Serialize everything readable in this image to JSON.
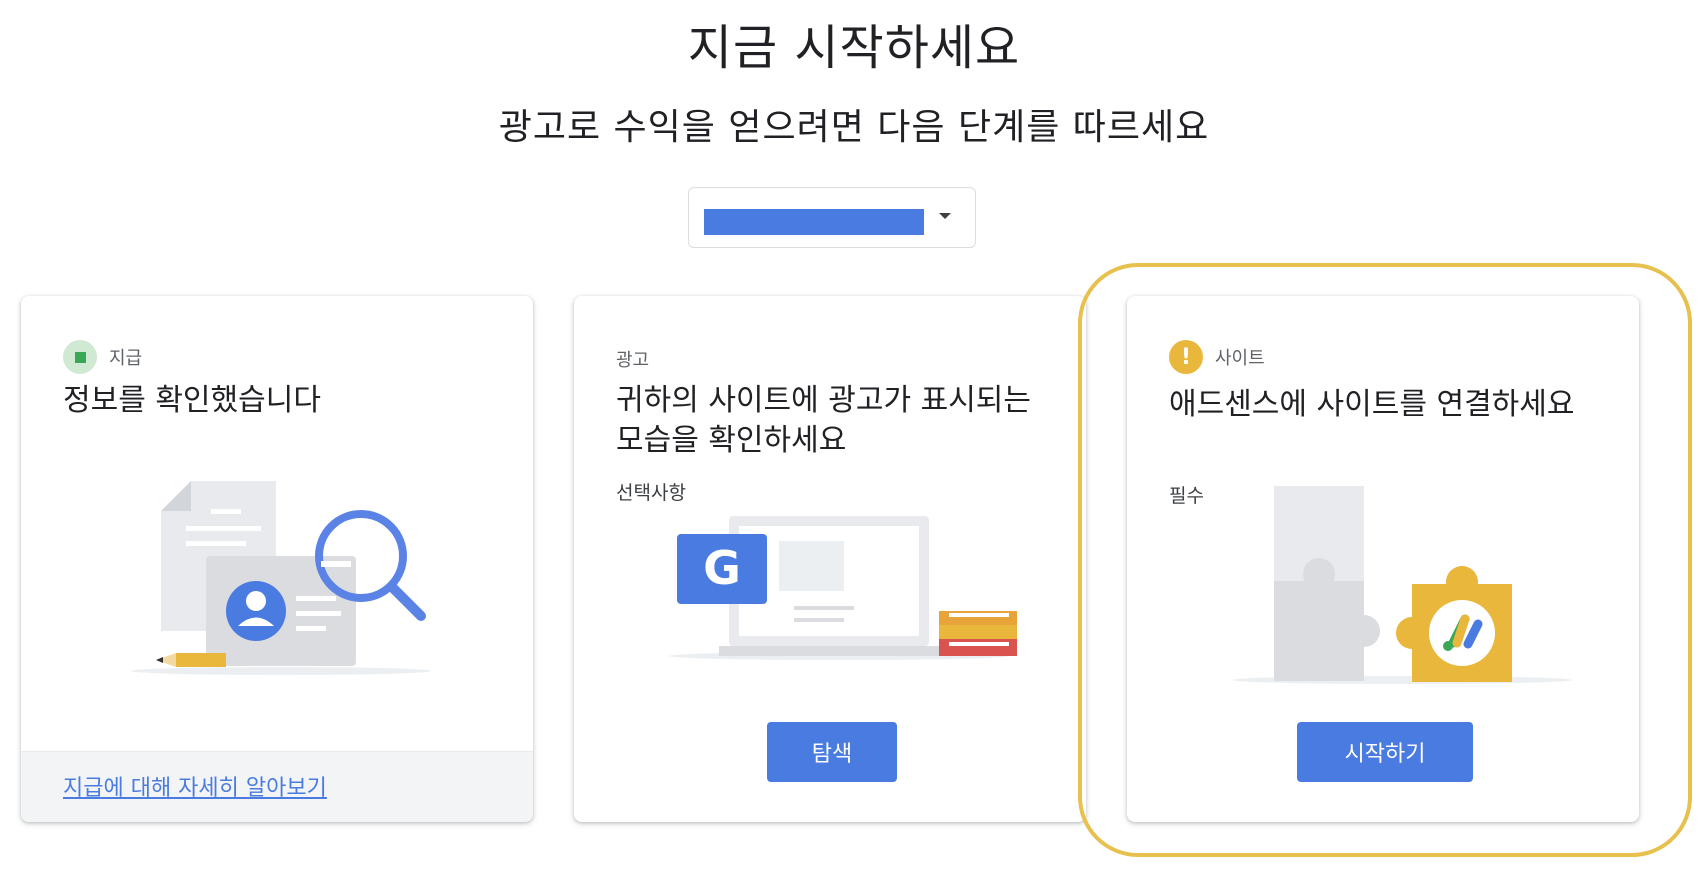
{
  "header": {
    "title": "지금 시작하세요",
    "subtitle": "광고로 수익을 얻으려면 다음 단계를 따르세요"
  },
  "site_selector": {
    "selected_value_redacted": true
  },
  "cards": [
    {
      "category": "지급",
      "status": "completed",
      "heading": "정보를 확인했습니다",
      "footer_link": "지급에 대해 자세히 알아보기"
    },
    {
      "category": "광고",
      "heading": "귀하의 사이트에 광고가 표시되는 모습을 확인하세요",
      "note": "선택사항",
      "button": "탐색"
    },
    {
      "category": "사이트",
      "status": "warning",
      "status_icon": "!",
      "heading": "애드센스에 사이트를 연결하세요",
      "note": "필수",
      "button": "시작하기"
    }
  ],
  "colors": {
    "primary_button": "#4a7be0",
    "warning": "#e8b73b",
    "success": "#3aa757",
    "highlight_ring": "#e8c04e"
  }
}
